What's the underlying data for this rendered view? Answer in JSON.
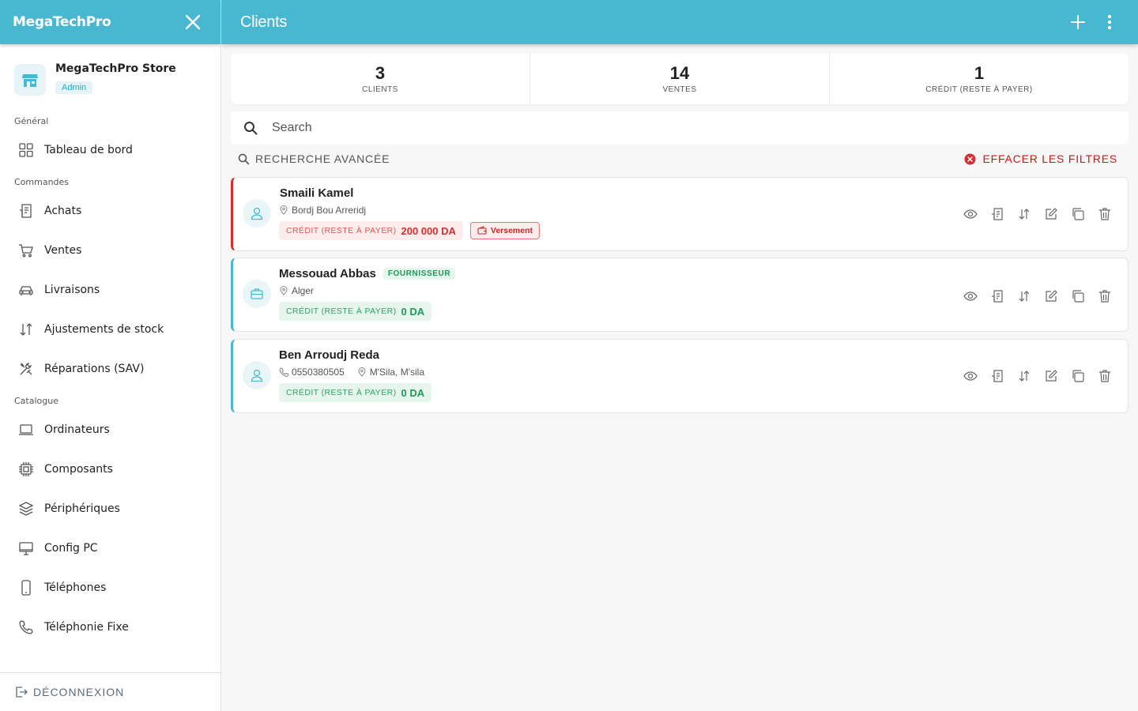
{
  "app": {
    "brand": "MegaTechPro"
  },
  "store": {
    "name": "MegaTechPro Store",
    "role": "Admin"
  },
  "sidebar": {
    "sections": [
      {
        "title": "Général",
        "items": [
          {
            "label": "Tableau de bord",
            "icon": "dashboard-icon"
          }
        ]
      },
      {
        "title": "Commandes",
        "items": [
          {
            "label": "Achats",
            "icon": "receipt-icon"
          },
          {
            "label": "Ventes",
            "icon": "cart-icon"
          },
          {
            "label": "Livraisons",
            "icon": "car-icon"
          },
          {
            "label": "Ajustements de stock",
            "icon": "swap-vertical-icon"
          },
          {
            "label": "Réparations (SAV)",
            "icon": "tools-icon"
          }
        ]
      },
      {
        "title": "Catalogue",
        "items": [
          {
            "label": "Ordinateurs",
            "icon": "laptop-icon"
          },
          {
            "label": "Composants",
            "icon": "chip-icon"
          },
          {
            "label": "Périphériques",
            "icon": "layers-icon"
          },
          {
            "label": "Config PC",
            "icon": "monitor-icon"
          },
          {
            "label": "Téléphones",
            "icon": "phone-mobile-icon"
          },
          {
            "label": "Téléphonie Fixe",
            "icon": "phone-icon"
          }
        ]
      }
    ],
    "logout": "DÉCONNEXION"
  },
  "header": {
    "title": "Clients"
  },
  "stats": [
    {
      "value": "3",
      "label": "CLIENTS"
    },
    {
      "value": "14",
      "label": "VENTES"
    },
    {
      "value": "1",
      "label": "CRÉDIT (RESTE À PAYER)"
    }
  ],
  "search": {
    "placeholder": "Search",
    "value": ""
  },
  "filters": {
    "advanced": "RECHERCHE AVANCÉE",
    "clear": "EFFACER LES FILTRES"
  },
  "credit_label": "CRÉDIT (RESTE À PAYER)",
  "versement_label": "Versement",
  "supplier_badge": "FOURNISSEUR",
  "clients": [
    {
      "name": "Smaili Kamel",
      "phone": "",
      "location": "Bordj Bou Arreridj",
      "credit": "200 000 DA",
      "status": "debt",
      "avatar": "person-icon"
    },
    {
      "name": "Messouad Abbas",
      "phone": "",
      "location": "Alger",
      "credit": "0 DA",
      "status": "clear",
      "avatar": "briefcase-icon"
    },
    {
      "name": "Ben Arroudj Reda",
      "phone": "0550380505",
      "location": "M'Sila, M'sila",
      "credit": "0 DA",
      "status": "clear",
      "avatar": "person-icon"
    }
  ],
  "colors": {
    "primary": "#48b7d0",
    "danger": "#d32f2f",
    "success": "#1d9a5a"
  }
}
